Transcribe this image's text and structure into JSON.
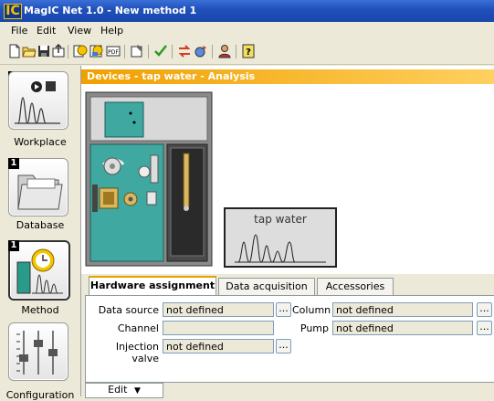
{
  "window": {
    "title": "MagIC Net 1.0 - New method 1",
    "logo": "IC"
  },
  "menu": [
    {
      "label": "File"
    },
    {
      "label": "Edit"
    },
    {
      "label": "View"
    },
    {
      "label": "Help"
    }
  ],
  "toolbar": {
    "icons": [
      "new-icon",
      "open-icon",
      "save-icon",
      "export-icon",
      "report-icon",
      "report2-icon",
      "pdf-icon",
      "properties-icon",
      "check-icon",
      "transfer-icon",
      "wizard-icon",
      "user-icon",
      "help-icon"
    ],
    "pdf_label": "PDF"
  },
  "sidebar": {
    "items": [
      {
        "num": "1",
        "label": "Workplace",
        "icon": "workplace-icon"
      },
      {
        "num": "1",
        "label": "Database",
        "icon": "database-icon"
      },
      {
        "num": "1",
        "label": "Method",
        "icon": "method-icon"
      },
      {
        "num": "",
        "label": "Configuration",
        "icon": "configuration-icon"
      }
    ]
  },
  "panel": {
    "title": "Devices - tap water - Analysis",
    "sample_label": "tap water"
  },
  "tabs": [
    {
      "label": "Hardware assignment",
      "active": true
    },
    {
      "label": "Data acquisition",
      "active": false
    },
    {
      "label": "Accessories",
      "active": false
    }
  ],
  "hardware": {
    "data_source_label": "Data source",
    "data_source_value": "not defined",
    "channel_label": "Channel",
    "channel_value": "",
    "injection_valve_label": "Injection valve",
    "injection_valve_value": "not defined",
    "column_label": "Column",
    "column_value": "not defined",
    "pump_label": "Pump",
    "pump_value": "not defined",
    "browse_label": "..."
  },
  "edit_button": {
    "label": "Edit",
    "caret": "▼"
  },
  "colors": {
    "titlebar": "#1f4fb8",
    "panel_header": "#f0a000",
    "instrument": "#3fa8a0"
  }
}
